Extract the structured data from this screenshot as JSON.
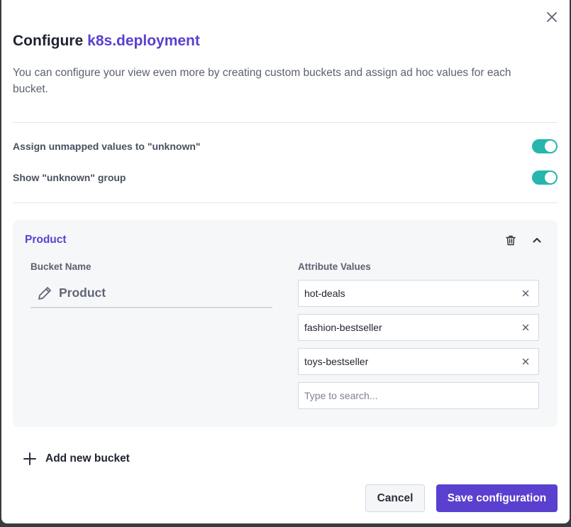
{
  "dialog": {
    "title_prefix": "Configure",
    "title_entity": "k8s.deployment",
    "description": "You can configure your view even more by creating custom buckets and assign ad hoc values for each bucket.",
    "close_icon": "close-icon"
  },
  "options": [
    {
      "label": "Assign unmapped values to \"unknown\"",
      "enabled": true
    },
    {
      "label": "Show \"unknown\" group",
      "enabled": true
    }
  ],
  "bucket": {
    "title": "Product",
    "delete_icon": "trash-icon",
    "collapse_icon": "chevron-up-icon",
    "name_label": "Bucket Name",
    "name_value": "Product",
    "values_label": "Attribute Values",
    "values": [
      "hot-deals",
      "fashion-bestseller",
      "toys-bestseller"
    ],
    "search_placeholder": "Type to search..."
  },
  "actions": {
    "add_bucket": "Add new bucket",
    "cancel": "Cancel",
    "save": "Save configuration"
  },
  "colors": {
    "accent": "#5b3fcf",
    "toggle_on": "#27b5ad",
    "panel_bg": "#f6f7f9"
  }
}
